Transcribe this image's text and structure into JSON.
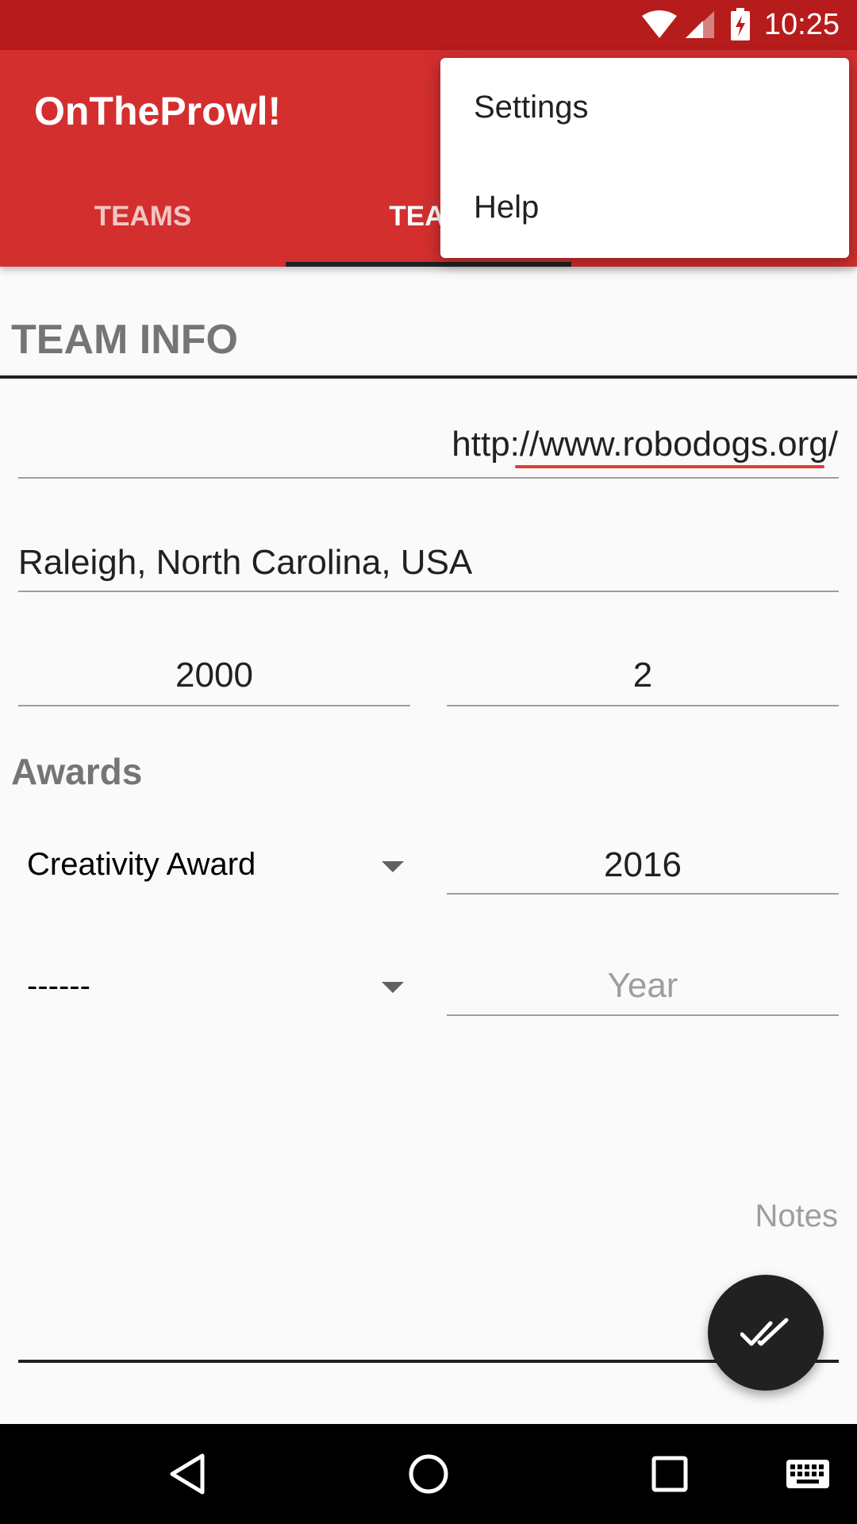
{
  "status_bar": {
    "time": "10:25",
    "icons": [
      "wifi-icon",
      "signal-icon",
      "battery-charging-icon"
    ]
  },
  "app_bar": {
    "title": "OnTheProwl!",
    "tabs": [
      {
        "label": "TEAMS",
        "selected": false
      },
      {
        "label": "TEAM",
        "selected": true
      }
    ]
  },
  "overflow_menu": {
    "items": [
      {
        "label": "Settings"
      },
      {
        "label": "Help"
      }
    ]
  },
  "team_info": {
    "section_title": "TEAM INFO",
    "website": "http://www.robodogs.org/",
    "location": "Raleigh, North Carolina, USA",
    "year_founded": "2000",
    "number": "2"
  },
  "awards": {
    "label": "Awards",
    "rows": [
      {
        "award": "Creativity Award",
        "year": "2016"
      },
      {
        "award": "------",
        "year_placeholder": "Year"
      }
    ]
  },
  "notes": {
    "placeholder": "Notes"
  },
  "fab": {
    "icon": "double-check-icon"
  },
  "nav_bar": {
    "icons": [
      "back-icon",
      "home-icon",
      "recents-icon",
      "keyboard-icon"
    ]
  },
  "colors": {
    "primary": "#D32F2F",
    "primary_dark": "#B71C1C",
    "accent": "#212121",
    "spell_error": "#E53935"
  }
}
